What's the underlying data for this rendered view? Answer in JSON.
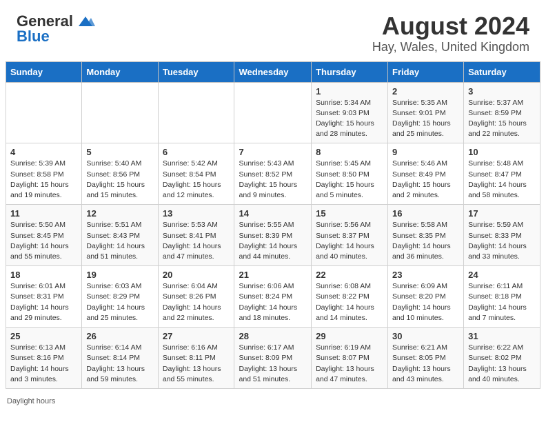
{
  "header": {
    "logo_general": "General",
    "logo_blue": "Blue",
    "title": "August 2024",
    "subtitle": "Hay, Wales, United Kingdom"
  },
  "days_of_week": [
    "Sunday",
    "Monday",
    "Tuesday",
    "Wednesday",
    "Thursday",
    "Friday",
    "Saturday"
  ],
  "weeks": [
    [
      {
        "day": "",
        "info": ""
      },
      {
        "day": "",
        "info": ""
      },
      {
        "day": "",
        "info": ""
      },
      {
        "day": "",
        "info": ""
      },
      {
        "day": "1",
        "info": "Sunrise: 5:34 AM\nSunset: 9:03 PM\nDaylight: 15 hours\nand 28 minutes."
      },
      {
        "day": "2",
        "info": "Sunrise: 5:35 AM\nSunset: 9:01 PM\nDaylight: 15 hours\nand 25 minutes."
      },
      {
        "day": "3",
        "info": "Sunrise: 5:37 AM\nSunset: 8:59 PM\nDaylight: 15 hours\nand 22 minutes."
      }
    ],
    [
      {
        "day": "4",
        "info": "Sunrise: 5:39 AM\nSunset: 8:58 PM\nDaylight: 15 hours\nand 19 minutes."
      },
      {
        "day": "5",
        "info": "Sunrise: 5:40 AM\nSunset: 8:56 PM\nDaylight: 15 hours\nand 15 minutes."
      },
      {
        "day": "6",
        "info": "Sunrise: 5:42 AM\nSunset: 8:54 PM\nDaylight: 15 hours\nand 12 minutes."
      },
      {
        "day": "7",
        "info": "Sunrise: 5:43 AM\nSunset: 8:52 PM\nDaylight: 15 hours\nand 9 minutes."
      },
      {
        "day": "8",
        "info": "Sunrise: 5:45 AM\nSunset: 8:50 PM\nDaylight: 15 hours\nand 5 minutes."
      },
      {
        "day": "9",
        "info": "Sunrise: 5:46 AM\nSunset: 8:49 PM\nDaylight: 15 hours\nand 2 minutes."
      },
      {
        "day": "10",
        "info": "Sunrise: 5:48 AM\nSunset: 8:47 PM\nDaylight: 14 hours\nand 58 minutes."
      }
    ],
    [
      {
        "day": "11",
        "info": "Sunrise: 5:50 AM\nSunset: 8:45 PM\nDaylight: 14 hours\nand 55 minutes."
      },
      {
        "day": "12",
        "info": "Sunrise: 5:51 AM\nSunset: 8:43 PM\nDaylight: 14 hours\nand 51 minutes."
      },
      {
        "day": "13",
        "info": "Sunrise: 5:53 AM\nSunset: 8:41 PM\nDaylight: 14 hours\nand 47 minutes."
      },
      {
        "day": "14",
        "info": "Sunrise: 5:55 AM\nSunset: 8:39 PM\nDaylight: 14 hours\nand 44 minutes."
      },
      {
        "day": "15",
        "info": "Sunrise: 5:56 AM\nSunset: 8:37 PM\nDaylight: 14 hours\nand 40 minutes."
      },
      {
        "day": "16",
        "info": "Sunrise: 5:58 AM\nSunset: 8:35 PM\nDaylight: 14 hours\nand 36 minutes."
      },
      {
        "day": "17",
        "info": "Sunrise: 5:59 AM\nSunset: 8:33 PM\nDaylight: 14 hours\nand 33 minutes."
      }
    ],
    [
      {
        "day": "18",
        "info": "Sunrise: 6:01 AM\nSunset: 8:31 PM\nDaylight: 14 hours\nand 29 minutes."
      },
      {
        "day": "19",
        "info": "Sunrise: 6:03 AM\nSunset: 8:29 PM\nDaylight: 14 hours\nand 25 minutes."
      },
      {
        "day": "20",
        "info": "Sunrise: 6:04 AM\nSunset: 8:26 PM\nDaylight: 14 hours\nand 22 minutes."
      },
      {
        "day": "21",
        "info": "Sunrise: 6:06 AM\nSunset: 8:24 PM\nDaylight: 14 hours\nand 18 minutes."
      },
      {
        "day": "22",
        "info": "Sunrise: 6:08 AM\nSunset: 8:22 PM\nDaylight: 14 hours\nand 14 minutes."
      },
      {
        "day": "23",
        "info": "Sunrise: 6:09 AM\nSunset: 8:20 PM\nDaylight: 14 hours\nand 10 minutes."
      },
      {
        "day": "24",
        "info": "Sunrise: 6:11 AM\nSunset: 8:18 PM\nDaylight: 14 hours\nand 7 minutes."
      }
    ],
    [
      {
        "day": "25",
        "info": "Sunrise: 6:13 AM\nSunset: 8:16 PM\nDaylight: 14 hours\nand 3 minutes."
      },
      {
        "day": "26",
        "info": "Sunrise: 6:14 AM\nSunset: 8:14 PM\nDaylight: 13 hours\nand 59 minutes."
      },
      {
        "day": "27",
        "info": "Sunrise: 6:16 AM\nSunset: 8:11 PM\nDaylight: 13 hours\nand 55 minutes."
      },
      {
        "day": "28",
        "info": "Sunrise: 6:17 AM\nSunset: 8:09 PM\nDaylight: 13 hours\nand 51 minutes."
      },
      {
        "day": "29",
        "info": "Sunrise: 6:19 AM\nSunset: 8:07 PM\nDaylight: 13 hours\nand 47 minutes."
      },
      {
        "day": "30",
        "info": "Sunrise: 6:21 AM\nSunset: 8:05 PM\nDaylight: 13 hours\nand 43 minutes."
      },
      {
        "day": "31",
        "info": "Sunrise: 6:22 AM\nSunset: 8:02 PM\nDaylight: 13 hours\nand 40 minutes."
      }
    ]
  ],
  "footer": "Daylight hours"
}
